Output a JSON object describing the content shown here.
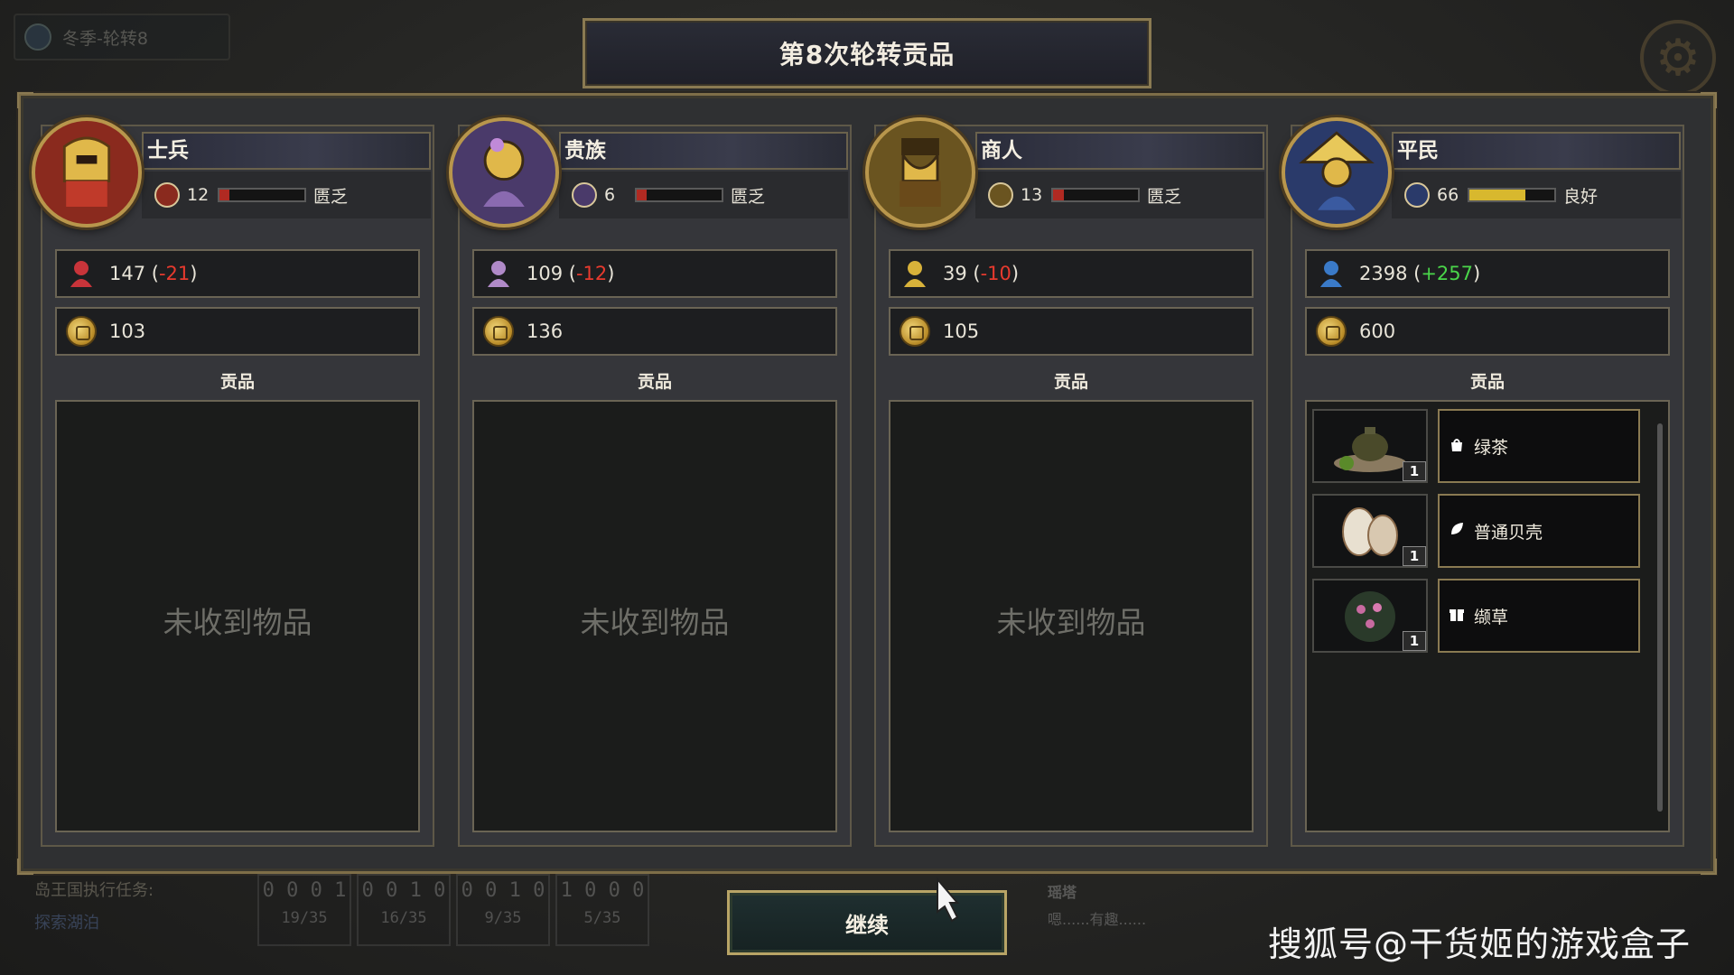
{
  "hud": {
    "season": "冬季-轮转8",
    "task_label": "岛王国执行任务:",
    "task_name": "探索湖泊",
    "counters": [
      {
        "digits": "0 0 0 1",
        "progress": "19/35"
      },
      {
        "digits": "0 0 1 0",
        "progress": "16/35"
      },
      {
        "digits": "0 0 1 0",
        "progress": "9/35"
      },
      {
        "digits": "1 0 0 0",
        "progress": "5/35"
      }
    ],
    "note_title": "瑶塔",
    "note_text": "嗯......有趣......"
  },
  "title": "第8次轮转贡品",
  "columns": [
    {
      "name": "士兵",
      "emblem_color": "#8a2a1e",
      "happiness": "12",
      "happiness_fraction": 0.12,
      "happiness_bar_color": "#b02a22",
      "status": "匮乏",
      "population": "147",
      "pop_change": "-21",
      "pop_change_type": "neg",
      "pop_icon_color": "#c8343a",
      "gold": "103",
      "tribute_label": "贡品",
      "empty_text": "未收到物品",
      "items": []
    },
    {
      "name": "贵族",
      "emblem_color": "#4a3a6a",
      "happiness": "6",
      "happiness_fraction": 0.06,
      "happiness_bar_color": "#b02a22",
      "status": "匮乏",
      "population": "109",
      "pop_change": "-12",
      "pop_change_type": "neg",
      "pop_icon_color": "#b08ac8",
      "gold": "136",
      "tribute_label": "贡品",
      "empty_text": "未收到物品",
      "items": []
    },
    {
      "name": "商人",
      "emblem_color": "#6a5420",
      "happiness": "13",
      "happiness_fraction": 0.13,
      "happiness_bar_color": "#b02a22",
      "status": "匮乏",
      "population": "39",
      "pop_change": "-10",
      "pop_change_type": "neg",
      "pop_icon_color": "#d8b23a",
      "gold": "105",
      "tribute_label": "贡品",
      "empty_text": "未收到物品",
      "items": []
    },
    {
      "name": "平民",
      "emblem_color": "#2a3a6a",
      "happiness": "66",
      "happiness_fraction": 0.66,
      "happiness_bar_color": "#d8b82e",
      "status": "良好",
      "population": "2398",
      "pop_change": "+257",
      "pop_change_type": "pos",
      "pop_icon_color": "#3a7ac8",
      "gold": "600",
      "tribute_label": "贡品",
      "empty_text": "",
      "items": [
        {
          "name": "绿茶",
          "qty": "1",
          "icon": "bag-icon",
          "thumb": "teapot"
        },
        {
          "name": "普通贝壳",
          "qty": "1",
          "icon": "leaf-icon",
          "thumb": "shell"
        },
        {
          "name": "缬草",
          "qty": "1",
          "icon": "gift-icon",
          "thumb": "herb"
        }
      ]
    }
  ],
  "continue_label": "继续",
  "watermark": "搜狐号@干货姬的游戏盒子"
}
